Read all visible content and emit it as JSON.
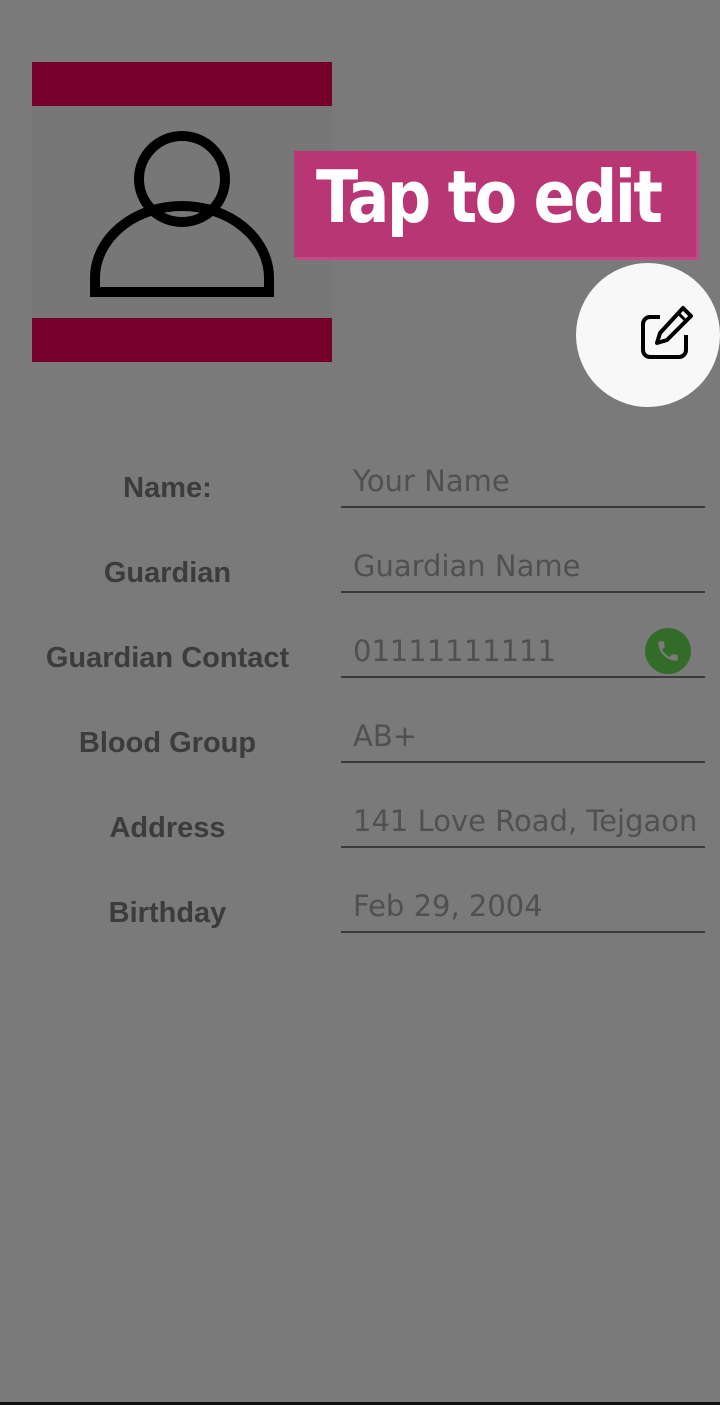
{
  "avatar": {
    "icon": "user-icon"
  },
  "coachmark": {
    "text": "Tap to edit"
  },
  "edit_button": {
    "icon": "edit-icon"
  },
  "form": {
    "fields": [
      {
        "label": "Name:",
        "placeholder": "Your Name"
      },
      {
        "label": "Guardian",
        "placeholder": "Guardian Name"
      },
      {
        "label": "Guardian Contact",
        "placeholder": "01111111111",
        "action_icon": "phone-icon"
      },
      {
        "label": "Blood Group",
        "placeholder": "AB+"
      },
      {
        "label": "Address",
        "placeholder": "141 Love Road, Tejgaon"
      },
      {
        "label": "Birthday",
        "placeholder": "Feb 29, 2004"
      }
    ]
  },
  "colors": {
    "overlay": "#7a7a7a",
    "avatar_band": "#76002a",
    "coachmark_background": "#b93674",
    "call_button": "#326c28"
  }
}
